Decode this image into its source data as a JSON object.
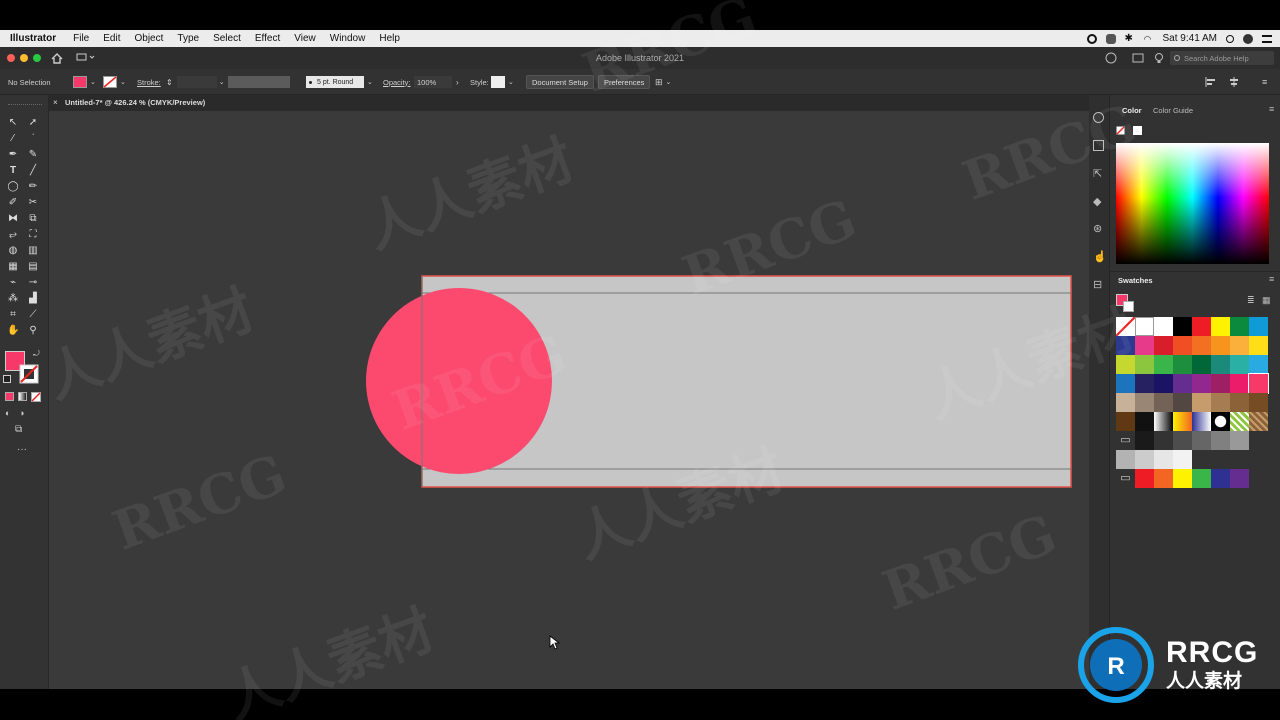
{
  "menubar": {
    "app_name": "Illustrator",
    "items": [
      "File",
      "Edit",
      "Object",
      "Type",
      "Select",
      "Effect",
      "View",
      "Window",
      "Help"
    ],
    "clock": "Sat 9:41 AM"
  },
  "titlebar": {
    "title": "Adobe Illustrator 2021",
    "search_placeholder": "Search Adobe Help"
  },
  "controlbar": {
    "selection": "No Selection",
    "fill_color": "#f7396a",
    "stroke_label": "Stroke:",
    "brush": "5 pt. Round",
    "opacity_label": "Opacity:",
    "opacity_value": "100%",
    "style_label": "Style:",
    "document_setup": "Document Setup",
    "preferences": "Preferences"
  },
  "document": {
    "tab_title": "Untitled-7* @ 426.24 % (CMYK/Preview)",
    "artwork": {
      "rect_fill": "#c6c6c6",
      "rect_stroke": "#e4544a",
      "circle_fill": "#fb4a6e"
    }
  },
  "panels": {
    "color_tab": "Color",
    "color_guide_tab": "Color Guide",
    "swatches_title": "Swatches"
  },
  "watermark": {
    "brand": "RRCG",
    "cn": "人人素材"
  }
}
